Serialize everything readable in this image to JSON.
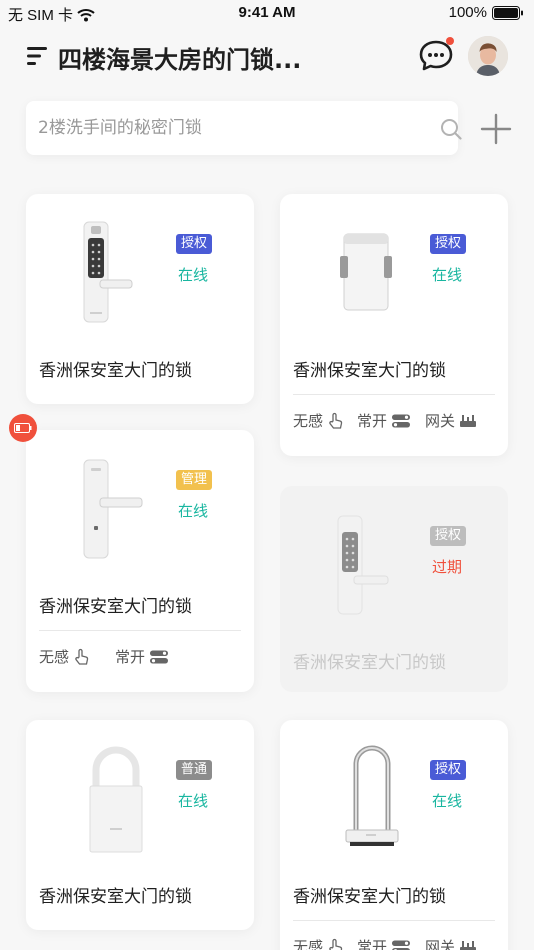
{
  "status_bar": {
    "carrier": "无 SIM 卡",
    "time": "9:41 AM",
    "battery": "100%"
  },
  "header": {
    "title": "四楼海景大房的门锁..."
  },
  "search": {
    "placeholder": "2楼洗手间的秘密门锁"
  },
  "colors": {
    "accent": "#4a5bd6",
    "online": "#19b6a0",
    "expired": "#f0503c",
    "manage": "#f2c14e"
  },
  "locks": [
    {
      "name": "香洲保安室大门的锁",
      "role": "授权",
      "status": "在线",
      "type": "door-lock-keypad",
      "features": []
    },
    {
      "name": "香洲保安室大门的锁",
      "role": "授权",
      "status": "在线",
      "type": "glass-door-lock",
      "features": [
        {
          "label": "无感",
          "icon": "touch-icon"
        },
        {
          "label": "常开",
          "icon": "toggle-icon"
        },
        {
          "label": "网关",
          "icon": "gateway-icon"
        }
      ]
    },
    {
      "name": "香洲保安室大门的锁",
      "role": "管理",
      "status": "在线",
      "type": "door-lock-plain",
      "low_battery": true,
      "features": [
        {
          "label": "无感",
          "icon": "touch-icon"
        },
        {
          "label": "常开",
          "icon": "toggle-icon"
        }
      ]
    },
    {
      "name": "香洲保安室大门的锁",
      "role": "授权",
      "status": "过期",
      "type": "door-lock-keypad",
      "features": []
    },
    {
      "name": "香洲保安室大门的锁",
      "role": "普通",
      "status": "在线",
      "type": "padlock",
      "features": []
    },
    {
      "name": "香洲保安室大门的锁",
      "role": "授权",
      "status": "在线",
      "type": "u-lock",
      "features": [
        {
          "label": "无感",
          "icon": "touch-icon"
        },
        {
          "label": "常开",
          "icon": "toggle-icon"
        },
        {
          "label": "网关",
          "icon": "gateway-icon"
        }
      ]
    }
  ]
}
